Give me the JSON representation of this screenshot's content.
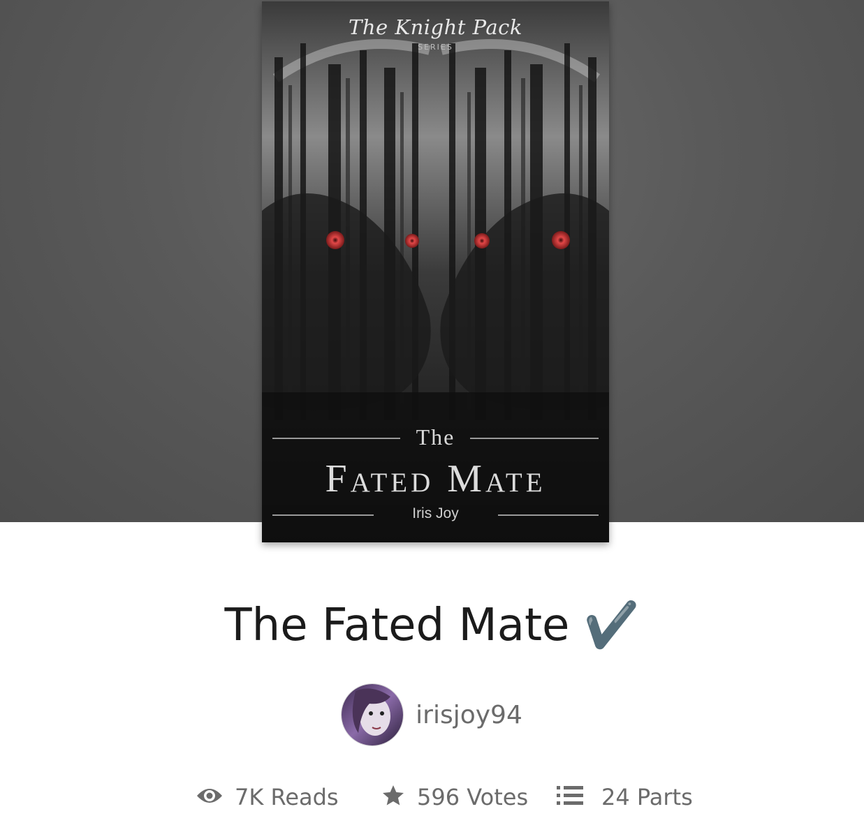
{
  "cover": {
    "series_title": "The Knight Pack",
    "series_label": "SERIES",
    "title_prefix": "The",
    "title_main": "Fated Mate",
    "author": "Iris Joy"
  },
  "story": {
    "title": "The Fated Mate ✔️"
  },
  "author": {
    "username": "irisjoy94"
  },
  "stats": {
    "reads": "7K Reads",
    "votes": "596 Votes",
    "parts": "24 Parts"
  },
  "icons": {
    "reads": "eye-icon",
    "votes": "star-icon",
    "parts": "list-icon"
  },
  "colors": {
    "hero_bg": "#5a5a5a",
    "eye_red": "#d23a3a",
    "text_dark": "#1b1b1b",
    "text_gray": "#6b6b6b"
  }
}
